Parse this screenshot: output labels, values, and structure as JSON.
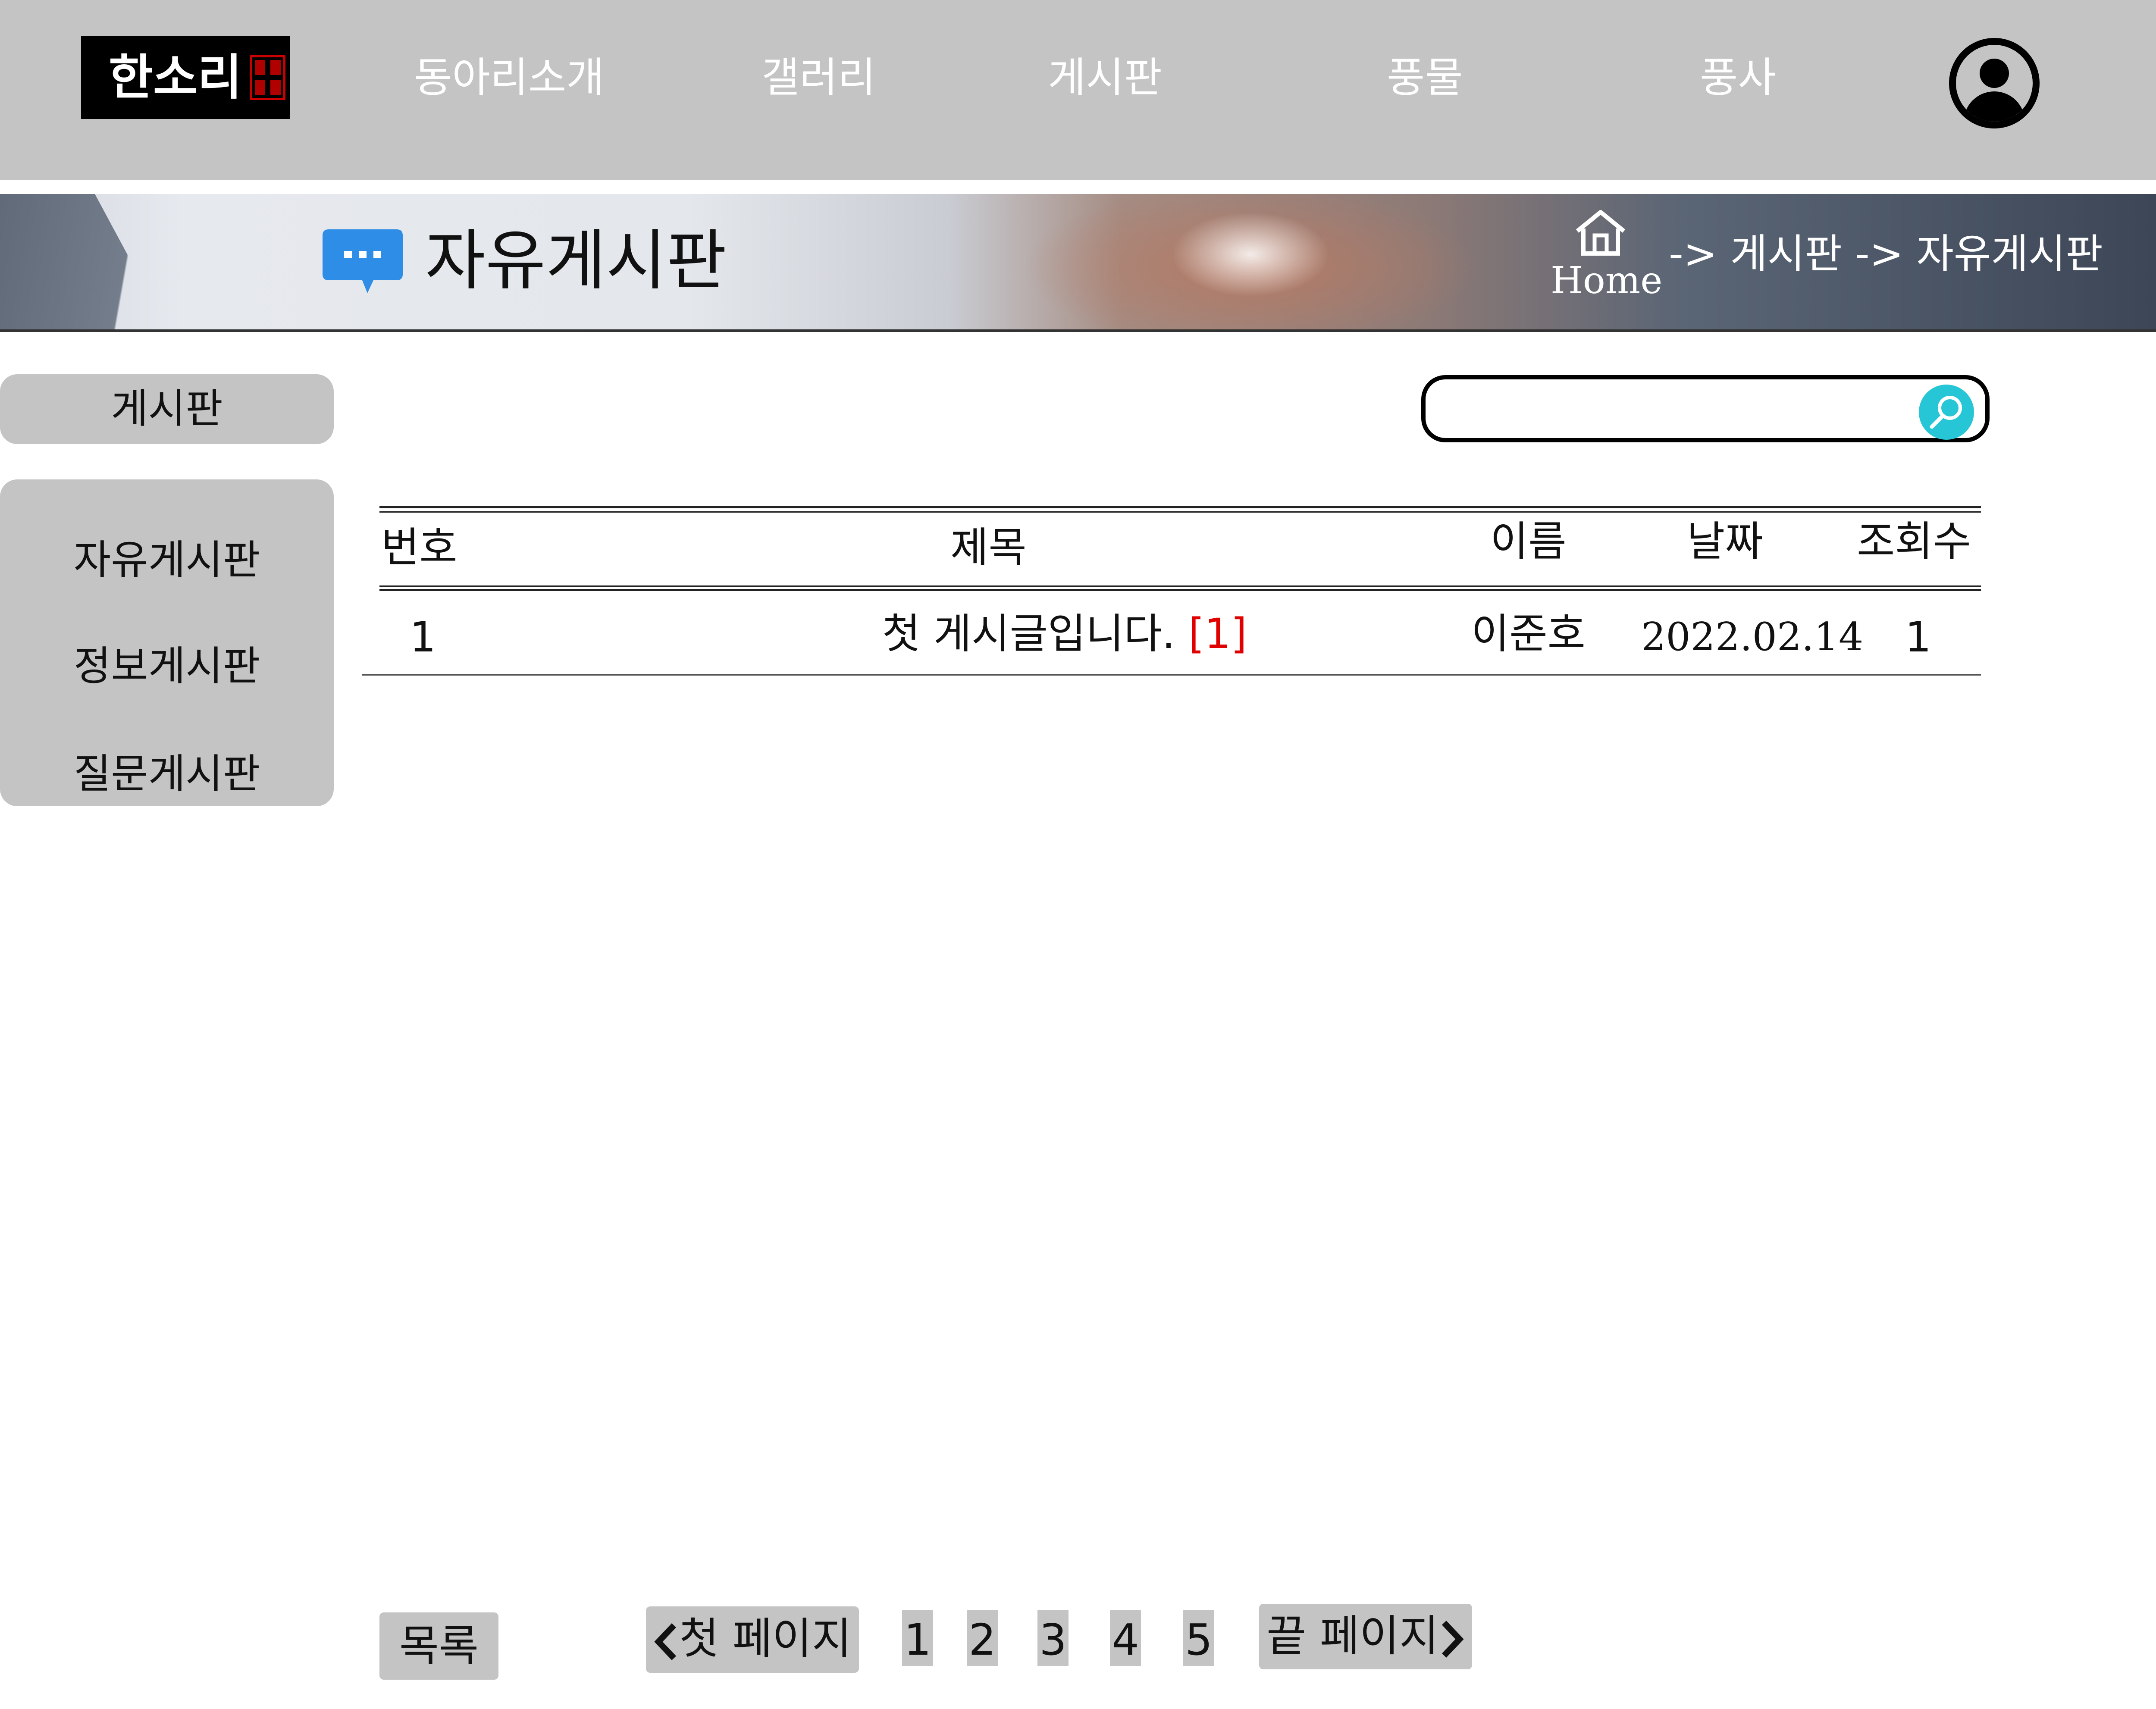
{
  "header": {
    "logo_text": "한소리",
    "nav": [
      "동아리소개",
      "갤러리",
      "게시판",
      "풍물",
      "풍사"
    ],
    "avatar_icon": "user-circle-icon"
  },
  "banner": {
    "icon": "chat-bubble-icon",
    "title": "자유게시판",
    "home_label": "Home",
    "breadcrumb": "-> 게시판 -> 자유게시판"
  },
  "sidebar": {
    "heading": "게시판",
    "items": [
      "자유게시판",
      "정보게시판",
      "질문게시판"
    ]
  },
  "search": {
    "placeholder": "",
    "button_icon": "search-icon",
    "accent": "#27c6d6"
  },
  "table": {
    "headers": {
      "no": "번호",
      "title": "제목",
      "name": "이름",
      "date": "날짜",
      "views": "조회수"
    },
    "rows": [
      {
        "no": "1",
        "title": "첫 게시글입니다.",
        "comments": "[1]",
        "name": "이준호",
        "date": "2022.02.14",
        "views": "1"
      }
    ]
  },
  "footer": {
    "list_button": "목록",
    "first_page": "첫 페이지",
    "last_page": "끝 페이지",
    "pages": [
      "1",
      "2",
      "3",
      "4",
      "5"
    ]
  },
  "colors": {
    "nav_bg": "#c4c4c4",
    "comment_count": "#e00000"
  }
}
